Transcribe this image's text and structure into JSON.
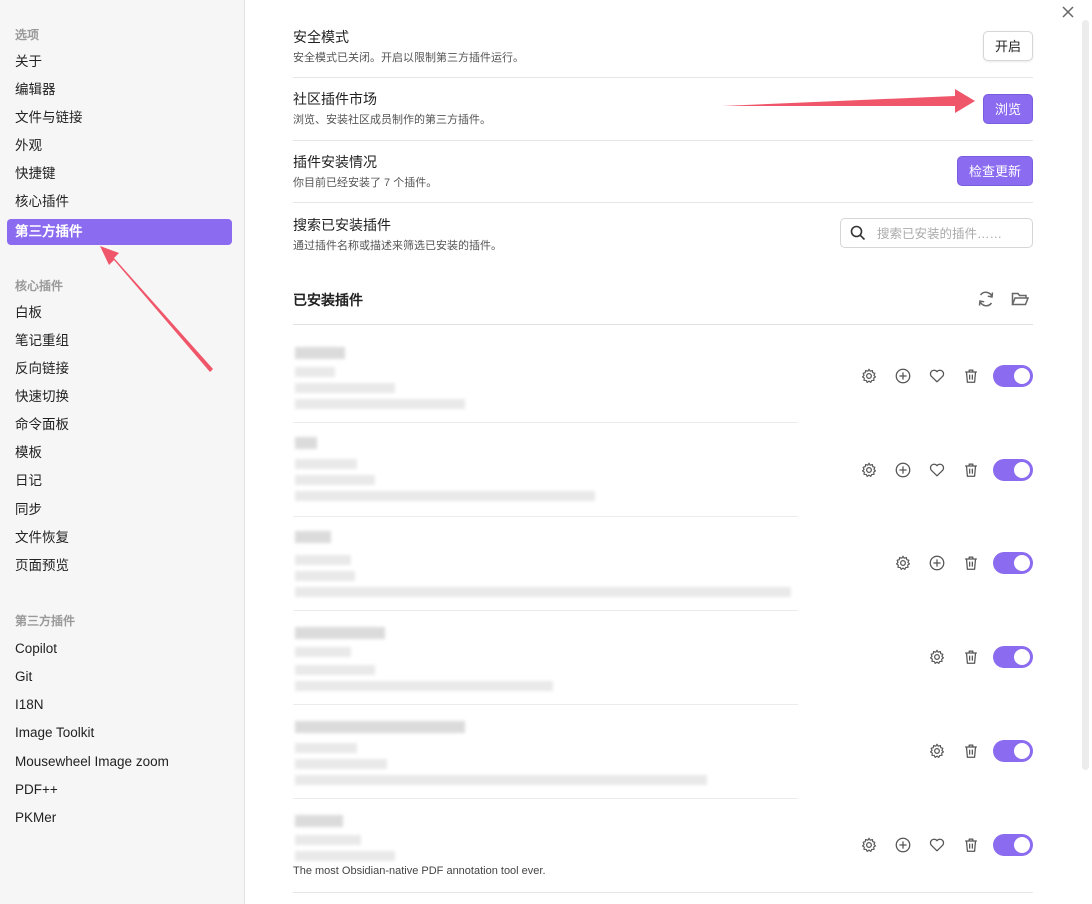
{
  "sidebar": {
    "options_heading": "选项",
    "options_items": [
      {
        "label": "关于"
      },
      {
        "label": "编辑器"
      },
      {
        "label": "文件与链接"
      },
      {
        "label": "外观"
      },
      {
        "label": "快捷键"
      },
      {
        "label": "核心插件"
      },
      {
        "label": "第三方插件",
        "active": true
      }
    ],
    "core_heading": "核心插件",
    "core_items": [
      {
        "label": "白板"
      },
      {
        "label": "笔记重组"
      },
      {
        "label": "反向链接"
      },
      {
        "label": "快速切换"
      },
      {
        "label": "命令面板"
      },
      {
        "label": "模板"
      },
      {
        "label": "日记"
      },
      {
        "label": "同步"
      },
      {
        "label": "文件恢复"
      },
      {
        "label": "页面预览"
      }
    ],
    "third_heading": "第三方插件",
    "third_items": [
      {
        "label": "Copilot"
      },
      {
        "label": "Git"
      },
      {
        "label": "I18N"
      },
      {
        "label": "Image Toolkit"
      },
      {
        "label": "Mousewheel Image zoom"
      },
      {
        "label": "PDF++"
      },
      {
        "label": "PKMer"
      }
    ]
  },
  "main": {
    "close_icon": "close-icon",
    "safe_mode": {
      "name": "安全模式",
      "desc": "安全模式已关闭。开启以限制第三方插件运行。",
      "button": "开启"
    },
    "market": {
      "name": "社区插件市场",
      "desc": "浏览、安装社区成员制作的第三方插件。",
      "button": "浏览"
    },
    "installed_info": {
      "name": "插件安装情况",
      "desc": "你目前已经安装了 7 个插件。",
      "button": "检查更新"
    },
    "search": {
      "name": "搜索已安装插件",
      "desc": "通过插件名称或描述来筛选已安装的插件。",
      "placeholder": "搜索已安装的插件……"
    },
    "installed_title": "已安装插件",
    "plugins": [
      {
        "actions": [
          "gear-icon",
          "plus-circle-icon",
          "heart-icon",
          "trash-icon"
        ],
        "enabled": true,
        "desc": ""
      },
      {
        "actions": [
          "gear-icon",
          "plus-circle-icon",
          "heart-icon",
          "trash-icon"
        ],
        "enabled": true,
        "desc": ""
      },
      {
        "actions": [
          "gear-icon",
          "plus-circle-icon",
          "trash-icon"
        ],
        "enabled": true,
        "desc": ""
      },
      {
        "actions": [
          "gear-icon",
          "trash-icon"
        ],
        "enabled": true,
        "desc": ""
      },
      {
        "actions": [
          "gear-icon",
          "trash-icon"
        ],
        "enabled": true,
        "desc": ""
      },
      {
        "actions": [
          "gear-icon",
          "plus-circle-icon",
          "heart-icon",
          "trash-icon"
        ],
        "enabled": true,
        "desc": "The most Obsidian-native PDF annotation tool ever."
      }
    ]
  },
  "colors": {
    "accent": "#8b6cf0",
    "arrow": "#f0566a"
  }
}
